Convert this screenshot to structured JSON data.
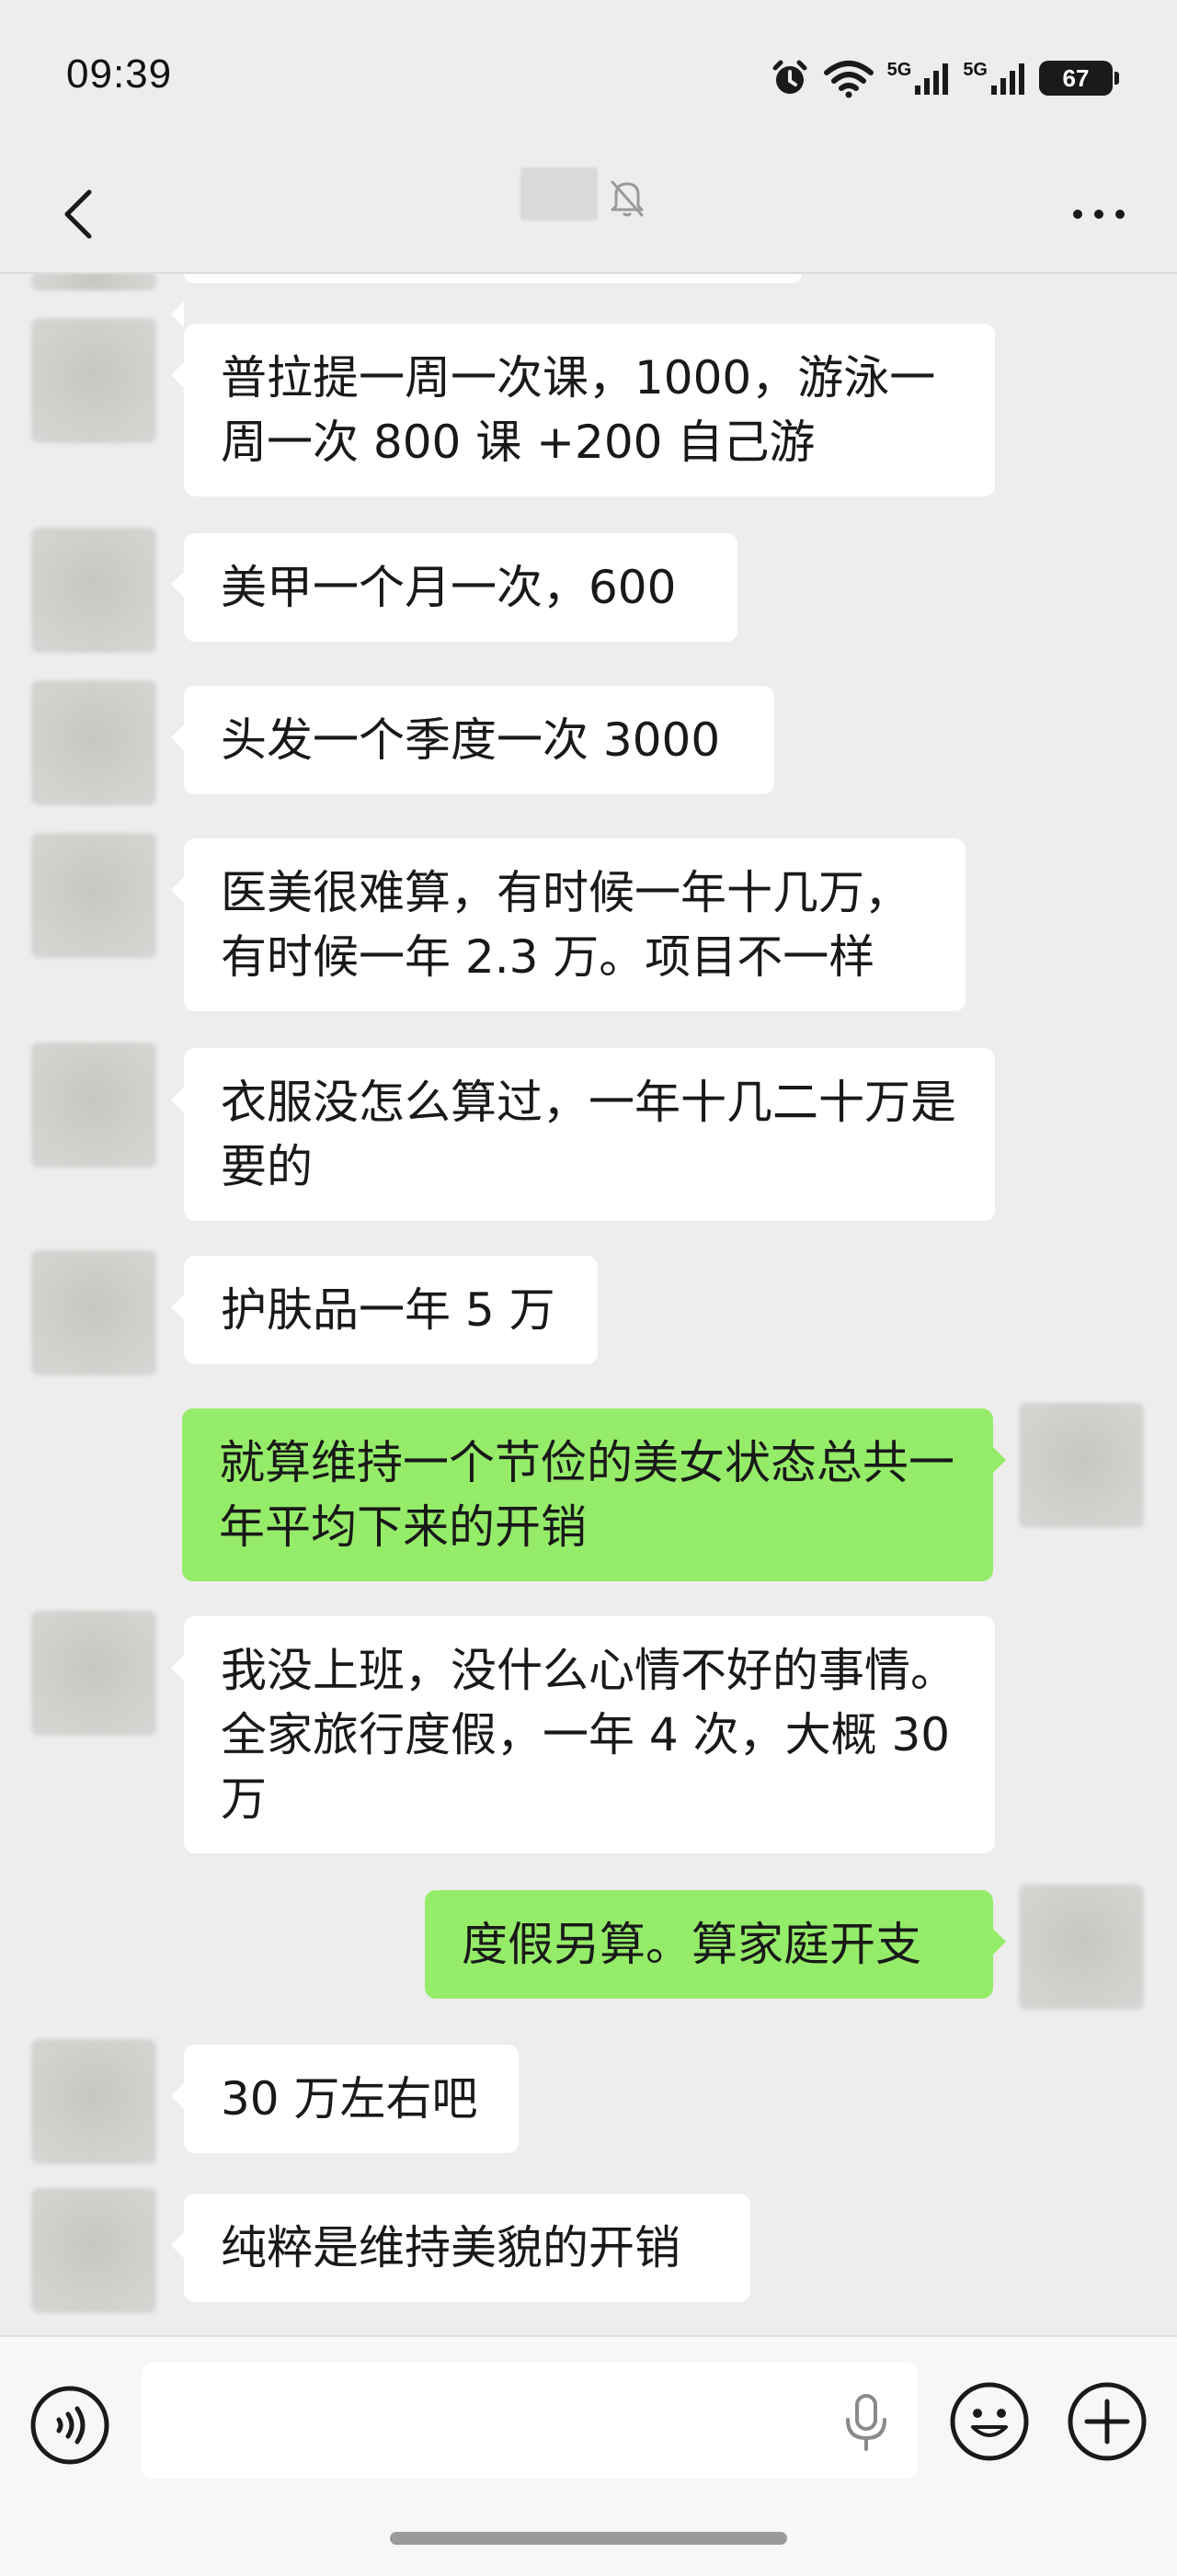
{
  "status_bar": {
    "time": "09:39",
    "network_1": "5G",
    "network_2": "5G",
    "battery": "67",
    "icons": [
      "alarm-icon",
      "wifi-icon",
      "signal-icon",
      "signal-icon",
      "battery-icon"
    ]
  },
  "nav": {
    "back_icon": "chevron-left-icon",
    "mute_icon": "bell-off-icon",
    "more_icon": "more-dots-icon"
  },
  "messages": [
    {
      "side": "them",
      "text": "普拉提一周一次课，1000，游泳一周一次 800 课 +200 自己游"
    },
    {
      "side": "them",
      "text": "美甲一个月一次，600"
    },
    {
      "side": "them",
      "text": "头发一个季度一次 3000"
    },
    {
      "side": "them",
      "text": "医美很难算，有时候一年十几万，有时候一年 2.3 万。项目不一样"
    },
    {
      "side": "them",
      "text": "衣服没怎么算过，一年十几二十万是要的"
    },
    {
      "side": "them",
      "text": "护肤品一年 5 万"
    },
    {
      "side": "me",
      "text": "就算维持一个节俭的美女状态总共一年平均下来的开销"
    },
    {
      "side": "them",
      "text": "我没上班，没什么心情不好的事情。全家旅行度假，一年 4 次，大概 30 万"
    },
    {
      "side": "me",
      "text": "度假另算。算家庭开支"
    },
    {
      "side": "them",
      "text": "30 万左右吧"
    },
    {
      "side": "them",
      "text": "纯粹是维持美貌的开销"
    }
  ],
  "input_bar": {
    "message_value": "",
    "voice_icon": "voice-icon",
    "mic_icon": "microphone-icon",
    "emoji_icon": "emoji-icon",
    "add_icon": "plus-circle-icon"
  },
  "colors": {
    "background": "#ededed",
    "bubble_them": "#ffffff",
    "bubble_me": "#95ec69"
  }
}
